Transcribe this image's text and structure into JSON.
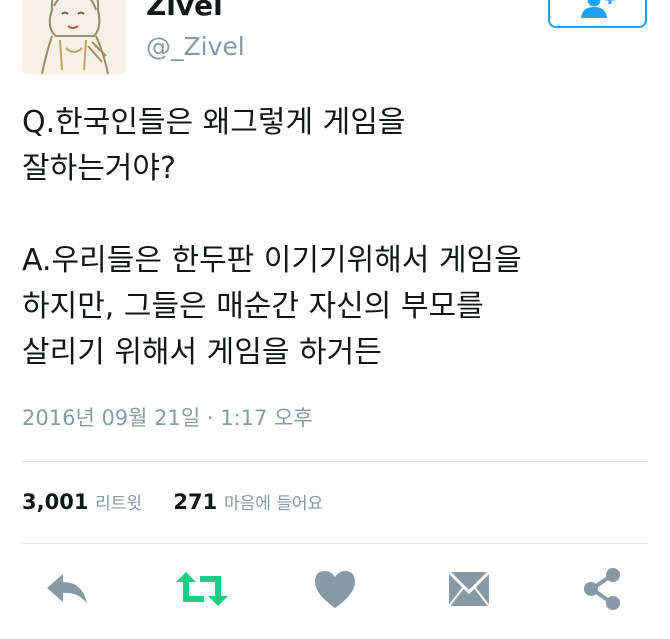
{
  "profile": {
    "display_name": "Zivel",
    "handle": "@_Zivel",
    "avatar_icon": "cartoon-character-avatar"
  },
  "follow_button": {
    "icon": "follow-user-icon",
    "color": "#1da1f2"
  },
  "tweet": {
    "lines": [
      "Q.한국인들은 왜그렇게 게임을",
      "잘하는거야?",
      "",
      "A.우리들은 한두판 이기기위해서 게임을",
      "하지만, 그들은 매순간 자신의 부모를",
      "살리기 위해서 게임을 하거든"
    ],
    "timestamp": "2016년 09월 21일 · 1:17 오후"
  },
  "stats": {
    "retweets_count": "3,001",
    "retweets_label": "리트윗",
    "likes_count": "271",
    "likes_label": "마음에 들어요"
  },
  "actions": [
    {
      "icon": "reply-icon",
      "color": "#8899a6"
    },
    {
      "icon": "retweet-icon",
      "color": "#19cf86"
    },
    {
      "icon": "heart-icon",
      "color": "#8899a6"
    },
    {
      "icon": "direct-message-icon",
      "color": "#8899a6"
    },
    {
      "icon": "share-icon",
      "color": "#8899a6"
    }
  ]
}
